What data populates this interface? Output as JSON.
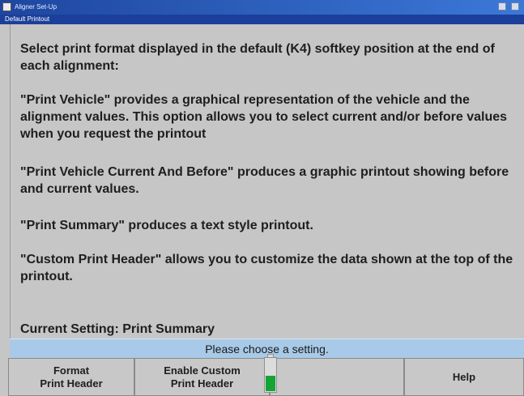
{
  "window": {
    "title": "Aligner Set-Up",
    "subtitle": "Default Printout"
  },
  "content": {
    "paragraphs": [
      "Select print format displayed in the default (K4) softkey position at the end of each alignment:",
      "\"Print Vehicle\" provides a graphical representation of the vehicle and the alignment values.  This option allows you to select current and/or before values when you request the printout",
      "\"Print Vehicle Current And Before\" produces a graphic printout showing before and current values.",
      "\"Print Summary\" produces a text style printout.",
      "\"Custom Print Header\" allows you to customize the data shown at the top of the printout."
    ],
    "current_setting": "Current Setting: Print Summary"
  },
  "status": {
    "prompt": "Please choose a setting."
  },
  "softkeys": [
    {
      "label": "Format\nPrint Header"
    },
    {
      "label": "Enable Custom\nPrint Header"
    },
    {
      "label": ""
    },
    {
      "label": "Help"
    }
  ],
  "battery": {
    "level": 0.45,
    "color": "#16a336"
  },
  "colors": {
    "titlebar": "#1e46a0",
    "panel_bg": "#c6c6c6",
    "status_bg": "#a8cae8"
  }
}
